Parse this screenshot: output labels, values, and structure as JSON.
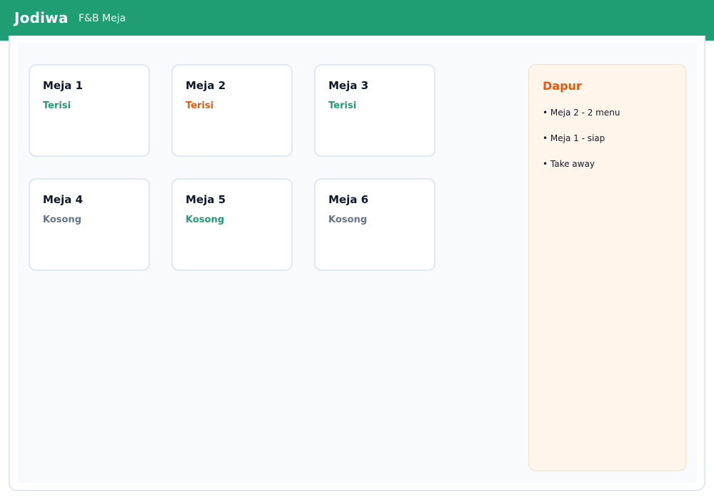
{
  "app": {
    "brand": "Jodiwa",
    "subtitle": "F&B Meja"
  },
  "tables": [
    {
      "name": "Meja 1",
      "status": "Terisi",
      "status_color": "#1f9e74"
    },
    {
      "name": "Meja 2",
      "status": "Terisi",
      "status_color": "#ea580c"
    },
    {
      "name": "Meja 3",
      "status": "Terisi",
      "status_color": "#1f9e74"
    },
    {
      "name": "Meja 4",
      "status": "Kosong",
      "status_color": "#64748b"
    },
    {
      "name": "Meja 5",
      "status": "Kosong",
      "status_color": "#1f9e74"
    },
    {
      "name": "Meja 6",
      "status": "Kosong",
      "status_color": "#64748b"
    }
  ],
  "kitchen": {
    "title": "Dapur",
    "items": [
      "• Meja 2 - 2 menu",
      "• Meja 1 - siap",
      "• Take away"
    ]
  },
  "colors": {
    "header": "#1f9e74",
    "kitchen_accent": "#ea580c",
    "kitchen_bg": "#fff5eb"
  }
}
